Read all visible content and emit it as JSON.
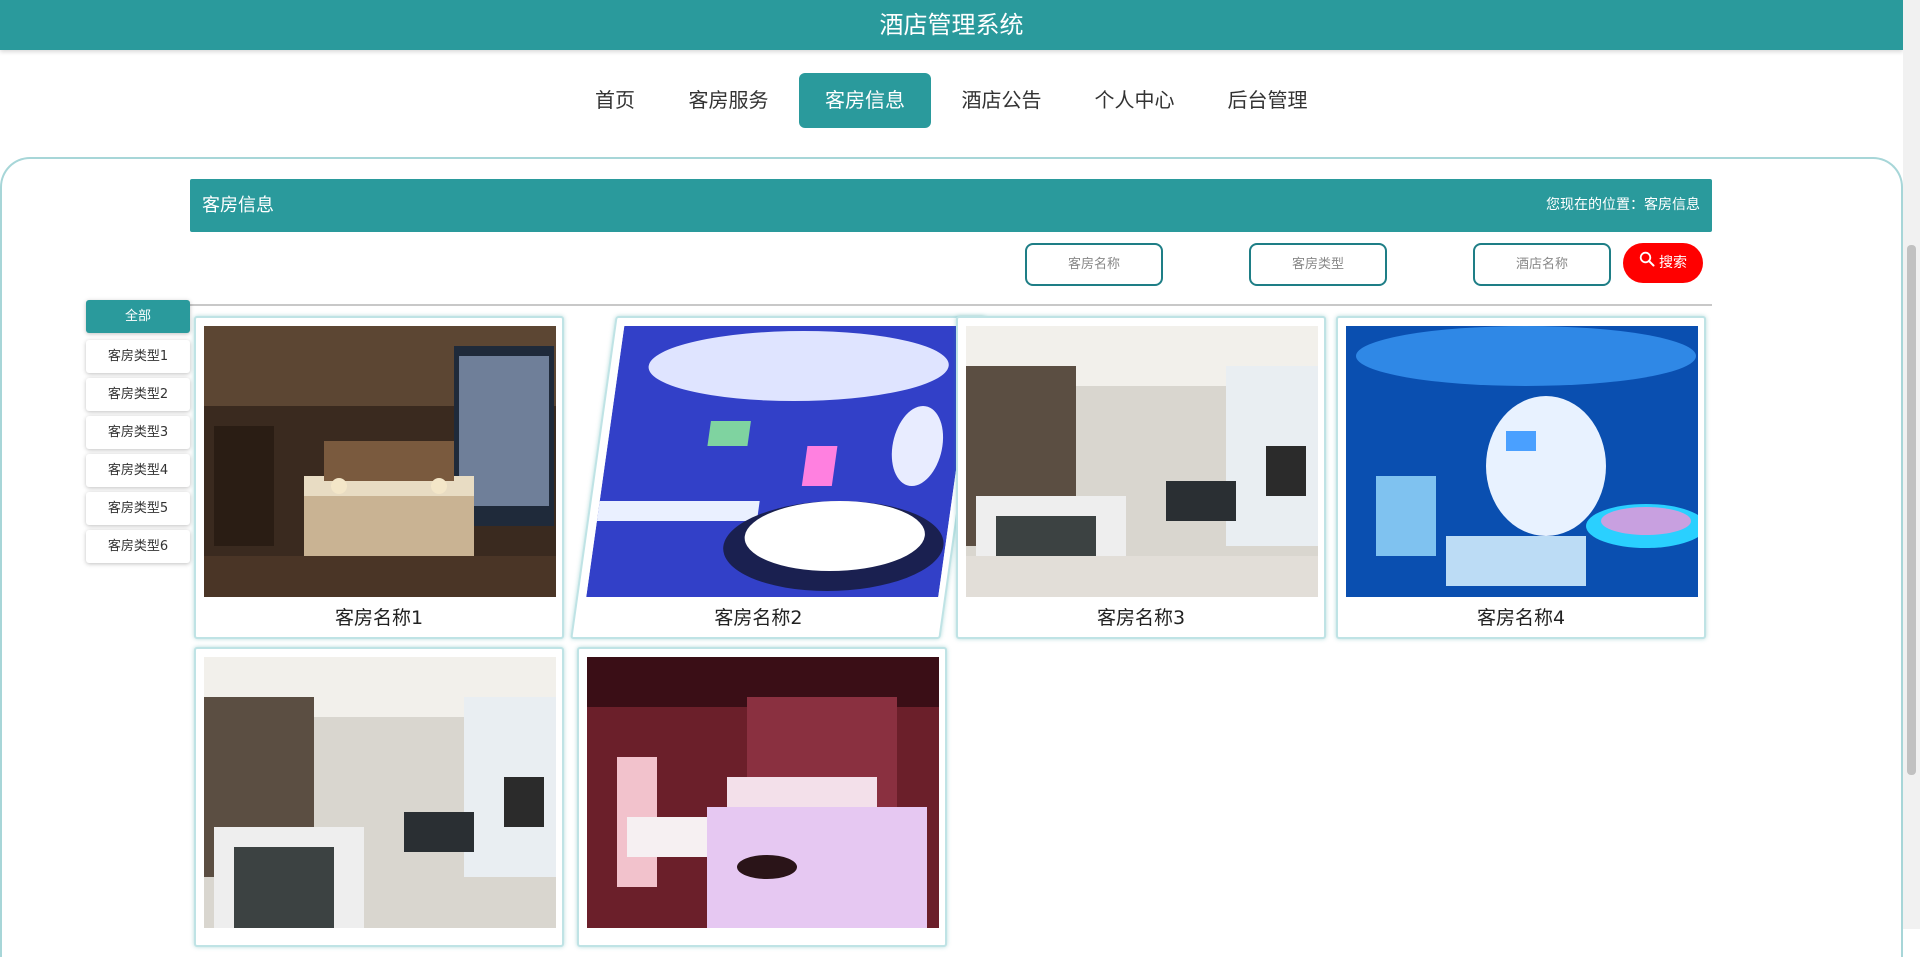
{
  "app": {
    "title": "酒店管理系统"
  },
  "nav": {
    "items": [
      {
        "label": "首页"
      },
      {
        "label": "客房服务"
      },
      {
        "label": "客房信息"
      },
      {
        "label": "酒店公告"
      },
      {
        "label": "个人中心"
      },
      {
        "label": "后台管理"
      }
    ],
    "active": "客房信息"
  },
  "page": {
    "title": "客房信息",
    "breadcrumb": "您现在的位置：客房信息"
  },
  "search": {
    "room_name_placeholder": "客房名称",
    "room_type_placeholder": "客房类型",
    "hotel_name_placeholder": "酒店名称",
    "button_label": "搜索"
  },
  "categories": [
    {
      "label": "全部",
      "active": true
    },
    {
      "label": "客房类型1"
    },
    {
      "label": "客房类型2"
    },
    {
      "label": "客房类型3"
    },
    {
      "label": "客房类型4"
    },
    {
      "label": "客房类型5"
    },
    {
      "label": "客房类型6"
    }
  ],
  "rooms": [
    {
      "name": "客房名称1",
      "image": "hotel-room-warm-suite"
    },
    {
      "name": "客房名称2",
      "image": "hotel-room-blue-themed"
    },
    {
      "name": "客房名称3",
      "image": "hotel-room-modern-window"
    },
    {
      "name": "客房名称4",
      "image": "hotel-room-ocean-theme"
    },
    {
      "name": "",
      "image": "hotel-room-modern-window"
    },
    {
      "name": "",
      "image": "hotel-room-pink-romantic"
    }
  ],
  "colors": {
    "primary": "#2a9a9c",
    "search_button": "#ff0000",
    "card_border": "#bfe3e5"
  }
}
